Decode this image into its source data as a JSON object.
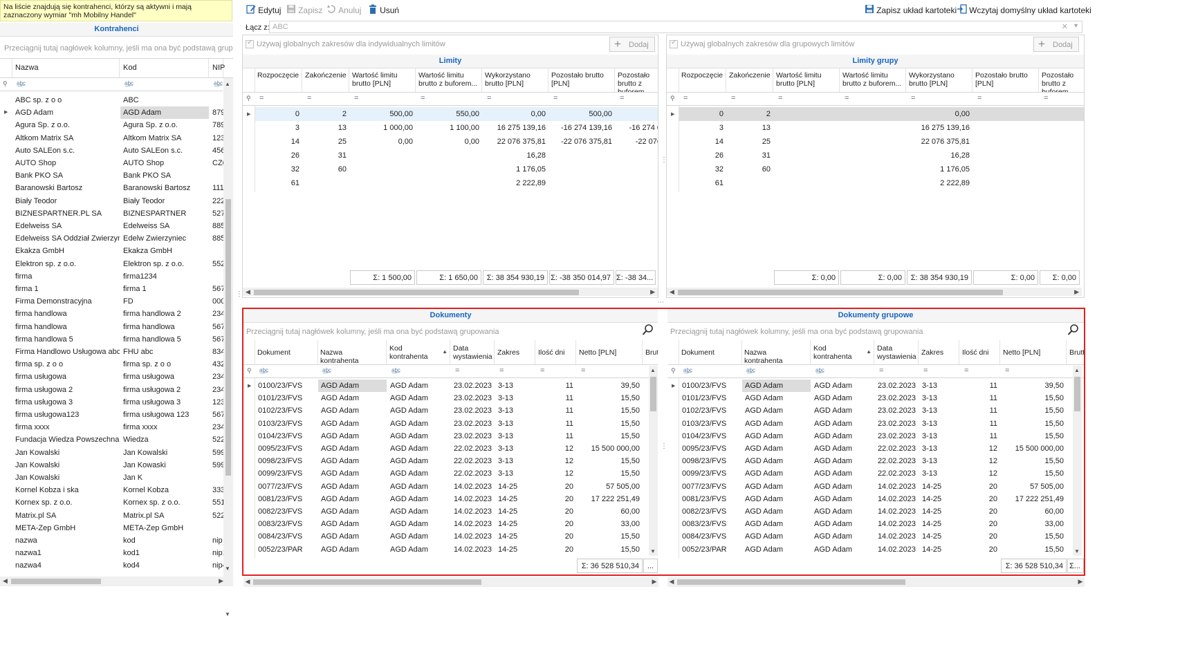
{
  "info_banner": "Na liście znajdują się kontrahenci, którzy są aktywni i mają zaznaczony wymiar \"mh Mobilny Handel\"",
  "left_panel": {
    "title": "Kontrahenci",
    "group_hint": "Przeciągnij tutaj nagłówek kolumny, jeśli ma ona być podstawą grupowania",
    "columns": [
      "Nazwa",
      "Kod",
      "NIP"
    ],
    "rows": [
      [
        "ABC sp. z o o",
        "ABC",
        ""
      ],
      [
        "AGD Adam",
        "AGD Adam",
        "879"
      ],
      [
        "Agura Sp. z o.o.",
        "Agura Sp. z o.o.",
        "789"
      ],
      [
        "Altkom Matrix SA",
        "Altkom Matrix SA",
        "123"
      ],
      [
        "Auto SALEon s.c.",
        "Auto SALEon s.c.",
        "456"
      ],
      [
        "AUTO Shop",
        "AUTO Shop",
        "CZ6"
      ],
      [
        "Bank PKO SA",
        "Bank PKO SA",
        ""
      ],
      [
        "Baranowski Bartosz",
        "Baranowski Bartosz",
        "111"
      ],
      [
        "Biały Teodor",
        "Biały Teodor",
        "222"
      ],
      [
        "BIZNESPARTNER.PL SA",
        "BIZNESPARTNER",
        "527"
      ],
      [
        "Edelweiss SA",
        "Edelweiss SA",
        "885"
      ],
      [
        "Edelweiss SA Oddział Zwierzyniec",
        "Edelw Zwierzyniec",
        "885"
      ],
      [
        "Ekakza GmbH",
        "Ekakza GmbH",
        ""
      ],
      [
        "Elektron sp. z o.o.",
        "Elektron sp. z o.o.",
        "552"
      ],
      [
        "firma",
        "firma1234",
        ""
      ],
      [
        "firma 1",
        "firma 1",
        "567"
      ],
      [
        "Firma Demonstracyjna",
        "FD",
        "000"
      ],
      [
        "firma handlowa",
        "firma handlowa 2",
        "234"
      ],
      [
        "firma handlowa",
        "firma handlowa",
        "567"
      ],
      [
        "firma handlowa 5",
        "firma handlowa 5",
        "567"
      ],
      [
        "Firma Handlowo Usługowa abc",
        "FHU abc",
        "834"
      ],
      [
        "firma sp. z o o",
        "firma sp. z o o",
        "432"
      ],
      [
        "firma usługowa",
        "firma usługowa",
        "234"
      ],
      [
        "firma usługowa 2",
        "firma usługowa 2",
        "234"
      ],
      [
        "firma usługowa 3",
        "firma usługowa 3",
        "123"
      ],
      [
        "firma usługowa123",
        "firma usługowa 123",
        "567"
      ],
      [
        "firma xxxx",
        "firma xxxx",
        "234"
      ],
      [
        "Fundacja Wiedza Powszechna",
        "Wiedza",
        "522"
      ],
      [
        "Jan Kowalski",
        "Jan Kowalski",
        "599"
      ],
      [
        "Jan Kowalski",
        "Jan Kowaski",
        "599"
      ],
      [
        "Jan Kowalski",
        "Jan K",
        ""
      ],
      [
        "Kornel Kobza i ska",
        "Kornel Kobza",
        "333"
      ],
      [
        "Kornex sp. z o.o.",
        "Kornex sp. z o.o.",
        "551"
      ],
      [
        "Matrix.pl SA",
        "Matrix.pl SA",
        "522"
      ],
      [
        "META-Zep GmbH",
        "META-Zep GmbH",
        ""
      ],
      [
        "nazwa",
        "kod",
        "nip"
      ],
      [
        "nazwa1",
        "kod1",
        "nip1"
      ],
      [
        "nazwa4",
        "kod4",
        "nip4"
      ]
    ]
  },
  "toolbar": {
    "edit": "Edytuj",
    "save": "Zapisz",
    "cancel": "Anuluj",
    "delete": "Usuń",
    "save_layout": "Zapisz układ kartoteki",
    "load_layout": "Wczytaj domyślny układ kartoteki"
  },
  "link": {
    "label": "Łącz z:",
    "value": "ABC"
  },
  "limits": {
    "checkbox_label": "Używaj globalnych zakresów dla indywidualnych limitów",
    "add_label": "Dodaj",
    "title": "Limity",
    "columns": [
      "Rozpoczęcie",
      "Zakończenie",
      "Wartość limitu brutto [PLN]",
      "Wartość limitu brutto z buforem...",
      "Wykorzystano brutto [PLN]",
      "Pozostało brutto [PLN]",
      "Pozostało brutto z buforem [PLN]"
    ],
    "rows": [
      [
        "0",
        "2",
        "500,00",
        "550,00",
        "0,00",
        "500,00",
        ""
      ],
      [
        "3",
        "13",
        "1 000,00",
        "1 100,00",
        "16 275 139,16",
        "-16 274 139,16",
        "-16 274 0"
      ],
      [
        "14",
        "25",
        "0,00",
        "0,00",
        "22 076 375,81",
        "-22 076 375,81",
        "-22 076"
      ],
      [
        "26",
        "31",
        "",
        "",
        "16,28",
        "",
        ""
      ],
      [
        "32",
        "60",
        "",
        "",
        "1 176,05",
        "",
        ""
      ],
      [
        "61",
        "",
        "",
        "",
        "2 222,89",
        "",
        ""
      ]
    ],
    "sums": [
      "Σ: 1 500,00",
      "Σ: 1 650,00",
      "Σ: 38 354 930,19",
      "Σ: -38 350 014,97",
      "Σ: -38 34..."
    ]
  },
  "group_limits": {
    "checkbox_label": "Używaj globalnych zakresów dla grupowych limitów",
    "add_label": "Dodaj",
    "title": "Limity grupy",
    "columns": [
      "Rozpoczęcie",
      "Zakończenie",
      "Wartość limitu brutto [PLN]",
      "Wartość limitu brutto z buforem...",
      "Wykorzystano brutto [PLN]",
      "Pozostało brutto [PLN]",
      "Pozostało brutto z buforem [PLN]"
    ],
    "rows": [
      [
        "0",
        "2",
        "",
        "",
        "0,00",
        "",
        ""
      ],
      [
        "3",
        "13",
        "",
        "",
        "16 275 139,16",
        "",
        ""
      ],
      [
        "14",
        "25",
        "",
        "",
        "22 076 375,81",
        "",
        ""
      ],
      [
        "26",
        "31",
        "",
        "",
        "16,28",
        "",
        ""
      ],
      [
        "32",
        "60",
        "",
        "",
        "1 176,05",
        "",
        ""
      ],
      [
        "61",
        "",
        "",
        "",
        "2 222,89",
        "",
        ""
      ]
    ],
    "sums": [
      "Σ: 0,00",
      "Σ: 0,00",
      "Σ: 38 354 930,19",
      "Σ: 0,00",
      "Σ: 0,00"
    ]
  },
  "documents": {
    "title": "Dokumenty",
    "group_hint": "Przeciągnij tutaj nagłówek kolumny, jeśli ma ona być podstawą grupowania",
    "columns": [
      "Dokument",
      "Nazwa kontrahenta",
      "Kod kontrahenta",
      "Data wystawienia",
      "Zakres",
      "Ilość dni",
      "Netto [PLN]",
      "Brutt"
    ],
    "rows": [
      [
        "0100/23/FVS",
        "AGD Adam",
        "AGD Adam",
        "23.02.2023",
        "3-13",
        "11",
        "39,50"
      ],
      [
        "0101/23/FVS",
        "AGD Adam",
        "AGD Adam",
        "23.02.2023",
        "3-13",
        "11",
        "15,50"
      ],
      [
        "0102/23/FVS",
        "AGD Adam",
        "AGD Adam",
        "23.02.2023",
        "3-13",
        "11",
        "15,50"
      ],
      [
        "0103/23/FVS",
        "AGD Adam",
        "AGD Adam",
        "23.02.2023",
        "3-13",
        "11",
        "15,50"
      ],
      [
        "0104/23/FVS",
        "AGD Adam",
        "AGD Adam",
        "23.02.2023",
        "3-13",
        "11",
        "15,50"
      ],
      [
        "0095/23/FVS",
        "AGD Adam",
        "AGD Adam",
        "22.02.2023",
        "3-13",
        "12",
        "15 500 000,00"
      ],
      [
        "0098/23/FVS",
        "AGD Adam",
        "AGD Adam",
        "22.02.2023",
        "3-13",
        "12",
        "15,50"
      ],
      [
        "0099/23/FVS",
        "AGD Adam",
        "AGD Adam",
        "22.02.2023",
        "3-13",
        "12",
        "15,50"
      ],
      [
        "0077/23/FVS",
        "AGD Adam",
        "AGD Adam",
        "14.02.2023",
        "14-25",
        "20",
        "57 505,00"
      ],
      [
        "0081/23/FVS",
        "AGD Adam",
        "AGD Adam",
        "14.02.2023",
        "14-25",
        "20",
        "17 222 251,49"
      ],
      [
        "0082/23/FVS",
        "AGD Adam",
        "AGD Adam",
        "14.02.2023",
        "14-25",
        "20",
        "60,00"
      ],
      [
        "0083/23/FVS",
        "AGD Adam",
        "AGD Adam",
        "14.02.2023",
        "14-25",
        "20",
        "33,00"
      ],
      [
        "0084/23/FVS",
        "AGD Adam",
        "AGD Adam",
        "14.02.2023",
        "14-25",
        "20",
        "15,50"
      ],
      [
        "0052/23/PAR",
        "AGD Adam",
        "AGD Adam",
        "14.02.2023",
        "14-25",
        "20",
        "15,50"
      ]
    ],
    "sum": "Σ: 36 528 510,34",
    "sum_more": "...",
    "group_sum_more": "Σ..."
  }
}
